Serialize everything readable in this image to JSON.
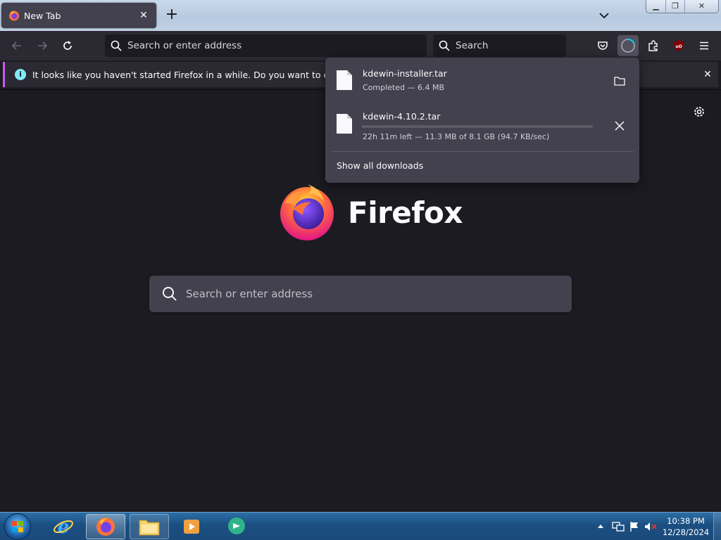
{
  "browser": {
    "tab": {
      "title": "New Tab",
      "close": "✕"
    },
    "new_tab": "+",
    "window_controls": {
      "minimize": "▁",
      "maximize": "❐",
      "close": "✕"
    }
  },
  "navbar": {
    "url_placeholder": "Search or enter address",
    "search_placeholder": "Search"
  },
  "notification": {
    "text": "It looks like you haven't started Firefox in a while. Do you want to clean it up for",
    "info": "i",
    "close": "✕"
  },
  "newtab": {
    "brand": "Firefox",
    "search_placeholder": "Search or enter address"
  },
  "downloads": {
    "items": [
      {
        "name": "kdewin-installer.tar",
        "status": "Completed — 6.4 MB",
        "action_icon": "folder-icon"
      },
      {
        "name": "kdewin-4.10.2.tar",
        "status": "22h 11m left — 11.3 MB of 8.1 GB (94.7 KB/sec)",
        "progress": 0.0014,
        "action_icon": "cancel-icon"
      }
    ],
    "show_all": "Show all downloads"
  },
  "taskbar": {
    "time": "10:38 PM",
    "date": "12/28/2024"
  },
  "colors": {
    "accent": "#c85aee",
    "background": "#1c1b22",
    "toolbar": "#2b2a33",
    "panel": "#42414d"
  }
}
